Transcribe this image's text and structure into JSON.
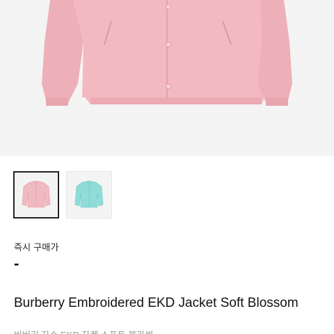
{
  "thumbnails": [
    {
      "color_name": "pink",
      "color": "#f1b9c0",
      "selected": true
    },
    {
      "color_name": "aqua",
      "color": "#8fdcd8",
      "selected": false
    }
  ],
  "product": {
    "hero_color": "#f2b8c0",
    "instant_buy_label": "즉시 구매가",
    "price": "-",
    "name": "Burberry Embroidered EKD Jacket Soft Blossom",
    "subtitle": "버버리 자수 EKD 자켓 소프트 블라썸"
  }
}
